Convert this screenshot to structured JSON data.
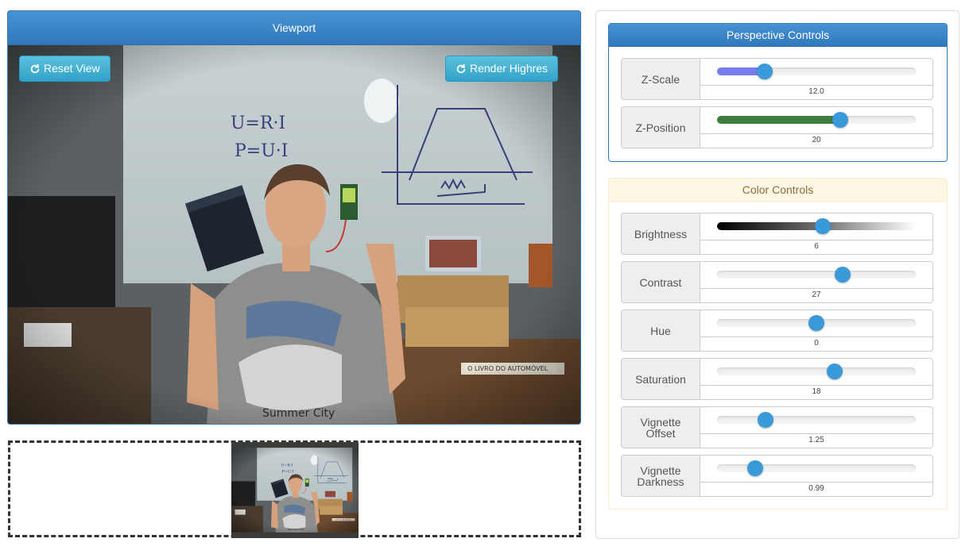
{
  "viewport": {
    "title": "Viewport",
    "reset_label": "Reset View",
    "render_label": "Render Highres",
    "image_icon": "photo-of-person-holding-box-and-battery",
    "board_text": [
      "U=R·I",
      "P=U·I"
    ],
    "book_text": "O LIVRO DO AUTOMÓVEL",
    "shirt_text": "Summer City"
  },
  "perspective": {
    "title": "Perspective Controls",
    "controls": [
      {
        "label": "Z-Scale",
        "value": "12.0",
        "fraction": 0.24,
        "fill": "#7b7bf0"
      },
      {
        "label": "Z-Position",
        "value": "20",
        "fraction": 0.62,
        "fill": "#3f7d3f"
      }
    ]
  },
  "color": {
    "title": "Color Controls",
    "controls": [
      {
        "label": "Brightness",
        "value": "6",
        "fraction": 0.53,
        "fill": "gradient"
      },
      {
        "label": "Contrast",
        "value": "27",
        "fraction": 0.63
      },
      {
        "label": "Hue",
        "value": "0",
        "fraction": 0.5
      },
      {
        "label": "Saturation",
        "value": "18",
        "fraction": 0.59
      },
      {
        "label": "Vignette\nOffset",
        "value": "1.25",
        "fraction": 0.245
      },
      {
        "label": "Vignette\nDarkness",
        "value": "0.99",
        "fraction": 0.19
      }
    ]
  },
  "colors": {
    "primary": "#3178bd",
    "warning_bg": "#fcf8e3",
    "warning_text": "#8a6d3b",
    "knob": "#3a9ad9",
    "info_button": "#31a3c8"
  }
}
